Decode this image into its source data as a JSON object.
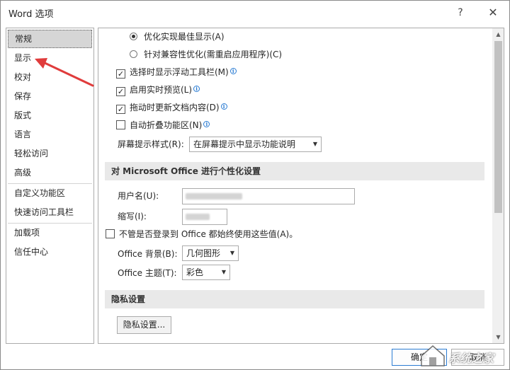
{
  "window": {
    "title": "Word 选项",
    "help_label": "?",
    "close_label": "✕"
  },
  "nav": {
    "items": [
      {
        "label": "常规"
      },
      {
        "label": "显示"
      },
      {
        "label": "校对"
      },
      {
        "label": "保存"
      },
      {
        "label": "版式"
      },
      {
        "label": "语言"
      },
      {
        "label": "轻松访问"
      },
      {
        "label": "高级"
      },
      {
        "label": "自定义功能区"
      },
      {
        "label": "快速访问工具栏"
      },
      {
        "label": "加载项"
      },
      {
        "label": "信任中心"
      }
    ],
    "selected": "常规"
  },
  "content": {
    "radio_best_display": "优化实现最佳显示(A)",
    "radio_compat": "针对兼容性优化(需重启应用程序)(C)",
    "check_mini_toolbar": "选择时显示浮动工具栏(M)",
    "check_live_preview": "启用实时预览(L)",
    "check_drag_update": "拖动时更新文档内容(D)",
    "check_collapse_ribbon": "自动折叠功能区(N)",
    "screentip_label": "屏幕提示样式(R):",
    "screentip_value": "在屏幕提示中显示功能说明",
    "personalize_header": "对 Microsoft Office 进行个性化设置",
    "username_label": "用户名(U):",
    "initials_label": "缩写(I):",
    "always_use_values": "不管是否登录到 Office 都始终使用这些值(A)。",
    "office_background_label": "Office 背景(B):",
    "office_background_value": "几何图形",
    "office_theme_label": "Office 主题(T):",
    "office_theme_value": "彩色",
    "privacy_header": "隐私设置",
    "privacy_button": "隐私设置..."
  },
  "footer": {
    "ok_label": "确定",
    "cancel_label": "取消"
  },
  "watermark": {
    "text": "系统之家"
  },
  "colors": {
    "annotation_arrow": "#e03c3c",
    "accent": "#2b7cd3"
  }
}
